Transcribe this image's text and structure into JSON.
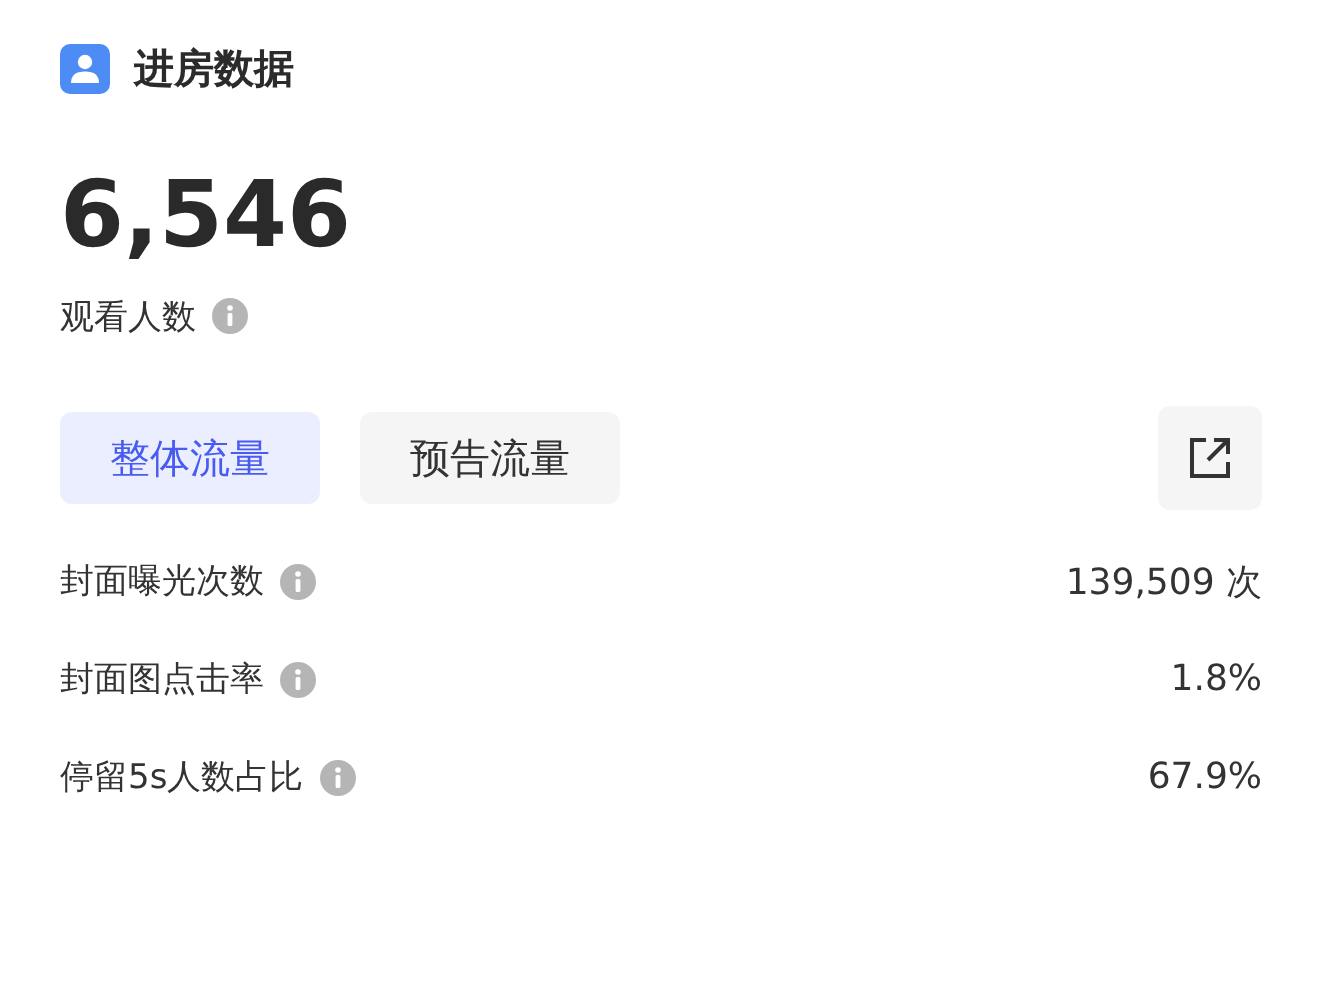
{
  "header": {
    "title": "进房数据"
  },
  "summary": {
    "value": "6,546",
    "label": "观看人数"
  },
  "tabs": [
    {
      "label": "整体流量",
      "selected": true
    },
    {
      "label": "预告流量",
      "selected": false
    }
  ],
  "metrics": [
    {
      "label": "封面曝光次数",
      "value": "139,509 次"
    },
    {
      "label": "封面图点击率",
      "value": "1.8%"
    },
    {
      "label": "停留5s人数占比",
      "value": "67.9%"
    }
  ]
}
